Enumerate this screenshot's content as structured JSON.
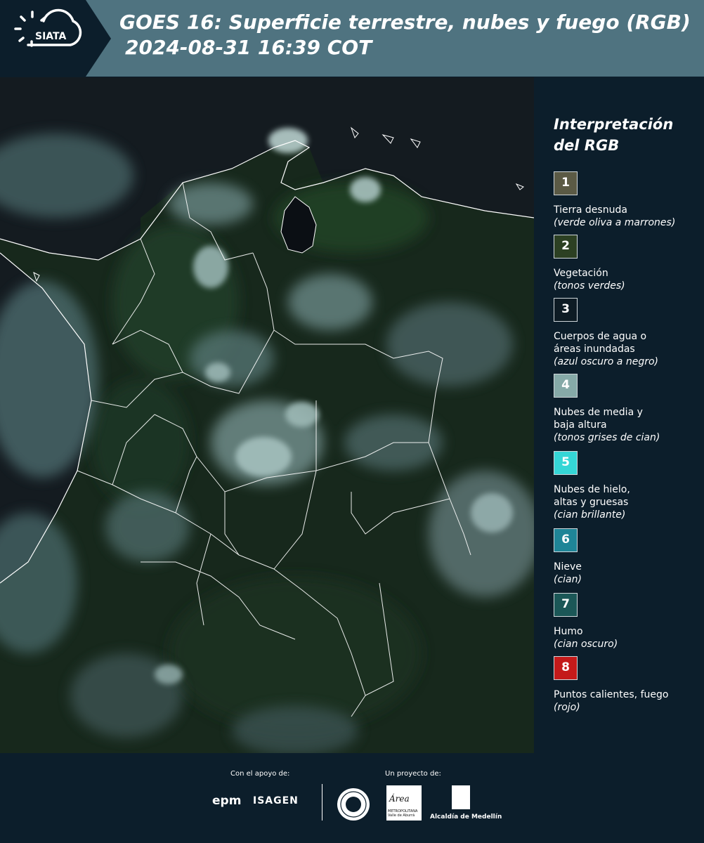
{
  "header": {
    "logo_text": "SIATA",
    "title_line1": "GOES 16: Superficie terrestre, nubes y fuego (RGB)",
    "title_line2": "2024-08-31 16:39 COT",
    "bg_color": "#4f7380",
    "logo_bg_color": "#0c1e2b"
  },
  "map": {
    "icon": "satellite-rgb-composite-map",
    "land_color": "#182b1e",
    "cloud_color": "#8fb3b0",
    "border_color": "#ffffff"
  },
  "legend": {
    "title_line1": "Interpretación",
    "title_line2": "del RGB",
    "items": [
      {
        "number": "1",
        "label": "Tierra desnuda",
        "note": "(verde oliva a marrones)",
        "color": "#5b5a45"
      },
      {
        "number": "2",
        "label": "Vegetación",
        "note": "(tonos verdes)",
        "color": "#2c4023"
      },
      {
        "number": "3",
        "label": "Cuerpos de agua o áreas inundadas",
        "note": "(azul oscuro a negro)",
        "color": "#0d1b24"
      },
      {
        "number": "4",
        "label": "Nubes de media y baja altura",
        "note": "(tonos grises de cian)",
        "color": "#86aaa8"
      },
      {
        "number": "5",
        "label": "Nubes de hielo, altas y gruesas",
        "note": "(cian brillante)",
        "color": "#35d6d6"
      },
      {
        "number": "6",
        "label": "Nieve",
        "note": "(cian)",
        "color": "#1f8597"
      },
      {
        "number": "7",
        "label": "Humo",
        "note": "(cian oscuro)",
        "color": "#1b5757"
      },
      {
        "number": "8",
        "label": "Puntos calientes, fuego",
        "note": "(rojo)",
        "color": "#c41a1a"
      }
    ]
  },
  "footer": {
    "support_label": "Con el apoyo de:",
    "project_label": "Un proyecto de:",
    "epm": "epm",
    "isagen": "ISAGEN",
    "area_text": "Área",
    "area_sub": "METROPOLITANA Valle de Aburrá",
    "alcaldia": "Alcaldía de Medellín"
  }
}
